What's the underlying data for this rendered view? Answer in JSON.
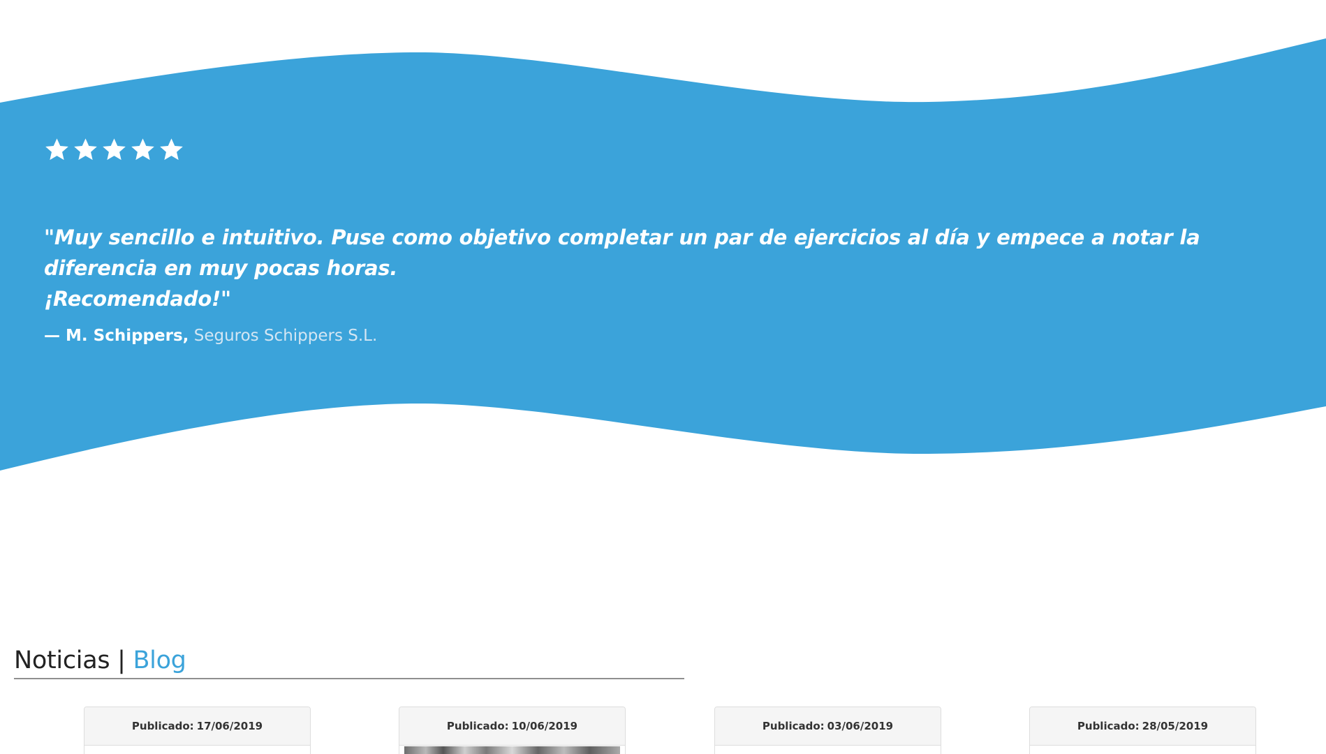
{
  "colors": {
    "wave_blue": "#3ba3da",
    "white": "#ffffff",
    "blog_accent": "#3ba3da",
    "heading_dark": "#222222"
  },
  "testimonial": {
    "rating": 5,
    "star_icon": "star-icon",
    "quote_line1": "\"Muy sencillo e intuitivo. Puse como objetivo completar un par de ejercicios al día y empece a notar la diferencia en muy pocas horas.",
    "quote_line2": "¡Recomendado!\"",
    "author_name": "— M. Schippers,",
    "author_company": "Seguros Schippers S.L."
  },
  "news": {
    "title_left": "Noticias | ",
    "title_right": "Blog",
    "cards": [
      {
        "label": "Publicado:",
        "date": "17/06/2019",
        "has_image": false
      },
      {
        "label": "Publicado:",
        "date": "10/06/2019",
        "has_image": true
      },
      {
        "label": "Publicado:",
        "date": "03/06/2019",
        "has_image": false
      },
      {
        "label": "Publicado:",
        "date": "28/05/2019",
        "has_image": false
      }
    ]
  }
}
